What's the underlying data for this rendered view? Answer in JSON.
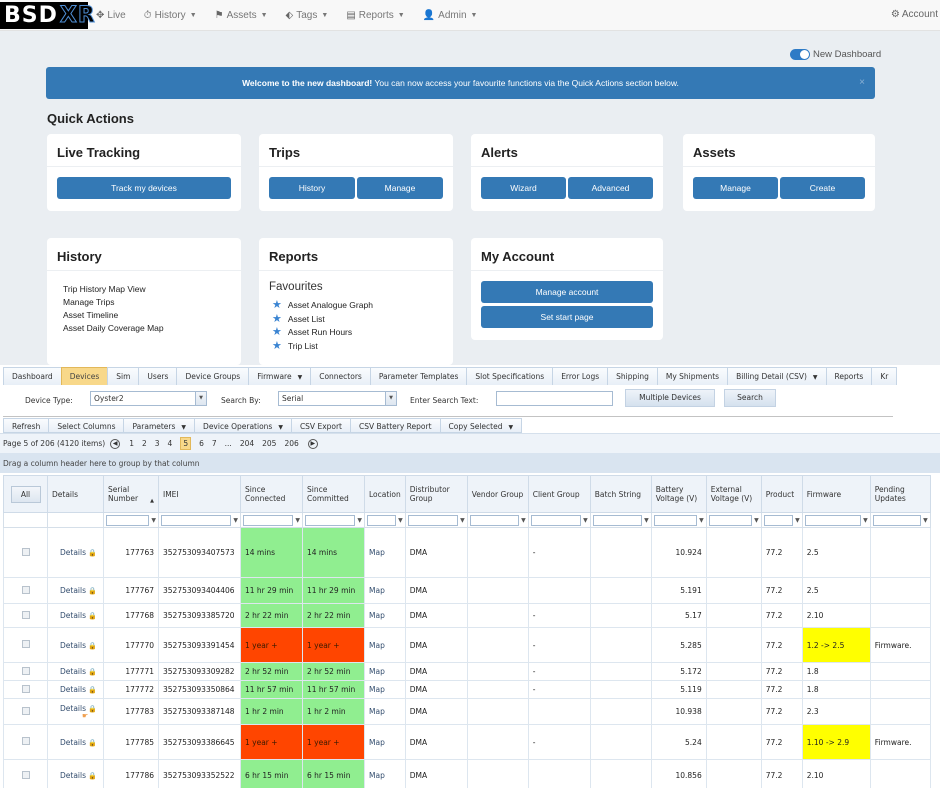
{
  "topnav": {
    "logo_main": "BSD",
    "logo_accent": "XR",
    "items": [
      {
        "label": "Live",
        "icon": "crosshair-icon",
        "glyph": "✥",
        "dropdown": false
      },
      {
        "label": "History",
        "icon": "clock-icon",
        "glyph": "⏱",
        "dropdown": true
      },
      {
        "label": "Assets",
        "icon": "flag-icon",
        "glyph": "⚑",
        "dropdown": true
      },
      {
        "label": "Tags",
        "icon": "tag-icon",
        "glyph": "⬖",
        "dropdown": true
      },
      {
        "label": "Reports",
        "icon": "report-icon",
        "glyph": "▤",
        "dropdown": true
      },
      {
        "label": "Admin",
        "icon": "user-icon",
        "glyph": "👤",
        "dropdown": true
      }
    ],
    "account_label": "Account",
    "account_glyph": "⚙"
  },
  "dashboard": {
    "toggle_label": "New Dashboard",
    "toggle_on": true,
    "banner_bold": "Welcome to the new dashboard!",
    "banner_text": " You can now access your favourite functions via the Quick Actions section below.",
    "banner_close": "×",
    "quick_actions_title": "Quick Actions",
    "cards": {
      "live_tracking": {
        "title": "Live Tracking",
        "buttons": [
          "Track my devices"
        ]
      },
      "trips": {
        "title": "Trips",
        "buttons": [
          "History",
          "Manage"
        ]
      },
      "alerts": {
        "title": "Alerts",
        "buttons": [
          "Wizard",
          "Advanced"
        ]
      },
      "assets": {
        "title": "Assets",
        "buttons": [
          "Manage",
          "Create"
        ]
      },
      "history": {
        "title": "History",
        "links": [
          "Trip History Map View",
          "Manage Trips",
          "Asset Timeline",
          "Asset Daily Coverage Map"
        ]
      },
      "reports": {
        "title": "Reports",
        "favourites_title": "Favourites",
        "favourites": [
          "Asset Analogue Graph",
          "Asset List",
          "Asset Run Hours",
          "Trip List"
        ]
      },
      "my_account": {
        "title": "My Account",
        "buttons": [
          "Manage account",
          "Set start page"
        ]
      }
    }
  },
  "devices_panel": {
    "tabs": [
      {
        "label": "Dashboard",
        "active": false,
        "dropdown": false
      },
      {
        "label": "Devices",
        "active": true,
        "dropdown": false
      },
      {
        "label": "Sim",
        "active": false,
        "dropdown": false
      },
      {
        "label": "Users",
        "active": false,
        "dropdown": false
      },
      {
        "label": "Device Groups",
        "active": false,
        "dropdown": false
      },
      {
        "label": "Firmware",
        "active": false,
        "dropdown": true
      },
      {
        "label": "Connectors",
        "active": false,
        "dropdown": false
      },
      {
        "label": "Parameter Templates",
        "active": false,
        "dropdown": false
      },
      {
        "label": "Slot Specifications",
        "active": false,
        "dropdown": false
      },
      {
        "label": "Error Logs",
        "active": false,
        "dropdown": false
      },
      {
        "label": "Shipping",
        "active": false,
        "dropdown": false
      },
      {
        "label": "My Shipments",
        "active": false,
        "dropdown": false
      },
      {
        "label": "Billing Detail (CSV)",
        "active": false,
        "dropdown": true
      },
      {
        "label": "Reports",
        "active": false,
        "dropdown": false
      },
      {
        "label": "Kr",
        "active": false,
        "dropdown": false
      }
    ],
    "search": {
      "device_type_label": "Device Type:",
      "device_type_value": "Oyster2",
      "search_by_label": "Search By:",
      "search_by_value": "Serial",
      "search_text_label": "Enter Search Text:",
      "search_text_value": "",
      "multiple_devices_button": "Multiple Devices",
      "search_button": "Search"
    },
    "toolbar": [
      {
        "label": "Refresh",
        "dropdown": false
      },
      {
        "label": "Select Columns",
        "dropdown": false
      },
      {
        "label": "Parameters",
        "dropdown": true
      },
      {
        "label": "Device Operations",
        "dropdown": true
      },
      {
        "label": "CSV Export",
        "dropdown": false
      },
      {
        "label": "CSV Battery Report",
        "dropdown": false
      },
      {
        "label": "Copy Selected",
        "dropdown": true
      }
    ],
    "pager": {
      "summary": "Page 5 of 206 (4120 items)",
      "current_page": 5,
      "pages": [
        "1",
        "2",
        "3",
        "4",
        "5",
        "6",
        "7",
        "...",
        "204",
        "205",
        "206"
      ]
    },
    "group_hint": "Drag a column header here to group by that column",
    "columns": [
      "All",
      "Details",
      "Serial Number",
      "IMEI",
      "Since Connected",
      "Since Committed",
      "Location",
      "Distributor Group",
      "Vendor Group",
      "Client Group",
      "Batch String",
      "Battery Voltage (V)",
      "External Voltage (V)",
      "Product",
      "Firmware",
      "Pending Updates"
    ],
    "sort": {
      "column": "Serial Number",
      "direction": "asc"
    },
    "rows": [
      {
        "details": "Details",
        "serial": "177763",
        "imei": "352753093407573",
        "since_connected": "14 mins",
        "since_committed": "14 mins",
        "status": "green",
        "location": "Map",
        "distributor": "DMA",
        "vendor": "",
        "client": "-",
        "batch": "",
        "battery": "10.924",
        "external": "",
        "product": "77.2",
        "firmware": "2.5",
        "firmware_pending": false,
        "pending": "",
        "tall": true
      },
      {
        "details": "Details",
        "serial": "177767",
        "imei": "352753093404406",
        "since_connected": "11 hr 29 min",
        "since_committed": "11 hr 29 min",
        "status": "green",
        "location": "Map",
        "distributor": "DMA",
        "vendor": "",
        "client": "",
        "batch": "",
        "battery": "5.191",
        "external": "",
        "product": "77.2",
        "firmware": "2.5",
        "firmware_pending": false,
        "pending": ""
      },
      {
        "details": "Details",
        "serial": "177768",
        "imei": "352753093385720",
        "since_connected": "2 hr 22 min",
        "since_committed": "2 hr 22 min",
        "status": "green",
        "location": "Map",
        "distributor": "DMA",
        "vendor": "",
        "client": "-",
        "batch": "",
        "battery": "5.17",
        "external": "",
        "product": "77.2",
        "firmware": "2.10",
        "firmware_pending": false,
        "pending": ""
      },
      {
        "details": "Details",
        "serial": "177770",
        "imei": "352753093391454",
        "since_connected": "1 year +",
        "since_committed": "1 year +",
        "status": "red",
        "location": "Map",
        "distributor": "DMA",
        "vendor": "",
        "client": "-",
        "batch": "",
        "battery": "5.285",
        "external": "",
        "product": "77.2",
        "firmware": "1.2 -> 2.5",
        "firmware_pending": true,
        "pending": "Firmware."
      },
      {
        "details": "Details",
        "serial": "177771",
        "imei": "352753093309282",
        "since_connected": "2 hr 52 min",
        "since_committed": "2 hr 52 min",
        "status": "green",
        "location": "Map",
        "distributor": "DMA",
        "vendor": "",
        "client": "-",
        "batch": "",
        "battery": "5.172",
        "external": "",
        "product": "77.2",
        "firmware": "1.8",
        "firmware_pending": false,
        "pending": ""
      },
      {
        "details": "Details",
        "serial": "177772",
        "imei": "352753093350864",
        "since_connected": "11 hr 57 min",
        "since_committed": "11 hr 57 min",
        "status": "green",
        "location": "Map",
        "distributor": "DMA",
        "vendor": "",
        "client": "-",
        "batch": "",
        "battery": "5.119",
        "external": "",
        "product": "77.2",
        "firmware": "1.8",
        "firmware_pending": false,
        "pending": ""
      },
      {
        "details": "Details",
        "serial": "177783",
        "imei": "352753093387148",
        "since_connected": "1 hr 2 min",
        "since_committed": "1 hr 2 min",
        "status": "green",
        "location": "Map",
        "distributor": "DMA",
        "vendor": "",
        "client": "",
        "batch": "",
        "battery": "10.938",
        "external": "",
        "product": "77.2",
        "firmware": "2.3",
        "firmware_pending": false,
        "pending": "",
        "hand": true
      },
      {
        "details": "Details",
        "serial": "177785",
        "imei": "352753093386645",
        "since_connected": "1 year +",
        "since_committed": "1 year +",
        "status": "red",
        "location": "Map",
        "distributor": "DMA",
        "vendor": "",
        "client": "-",
        "batch": "",
        "battery": "5.24",
        "external": "",
        "product": "77.2",
        "firmware": "1.10 -> 2.9",
        "firmware_pending": true,
        "pending": "Firmware."
      },
      {
        "details": "Details",
        "serial": "177786",
        "imei": "352753093352522",
        "since_connected": "6 hr 15 min",
        "since_committed": "6 hr 15 min",
        "status": "green",
        "location": "Map",
        "distributor": "DMA",
        "vendor": "",
        "client": "",
        "batch": "",
        "battery": "10.856",
        "external": "",
        "product": "77.2",
        "firmware": "2.10",
        "firmware_pending": false,
        "pending": ""
      }
    ]
  },
  "colors": {
    "brand_blue": "#3479b5",
    "active_tab": "#f8d88a",
    "status_ok": "#90ee90",
    "status_stale": "#ff4500",
    "pending_update": "#ffff00",
    "lock_green": "#3aa53a"
  }
}
